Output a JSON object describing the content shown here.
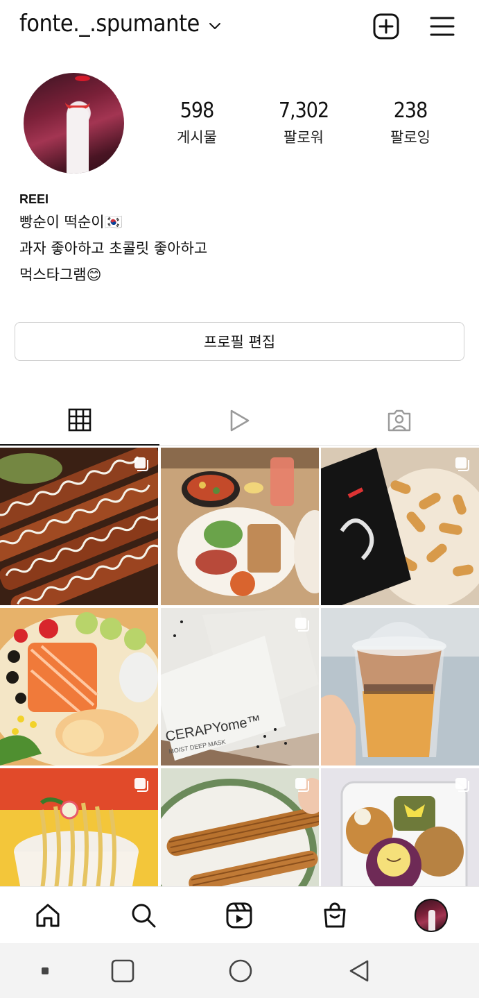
{
  "header": {
    "username": "fonte._.spumante",
    "icons": {
      "dropdown": "chevron-down-icon",
      "create": "plus-square-icon",
      "menu": "hamburger-menu-icon"
    }
  },
  "profile": {
    "stats": {
      "posts": {
        "value": "598",
        "label": "게시물"
      },
      "followers": {
        "value": "7,302",
        "label": "팔로워"
      },
      "following": {
        "value": "238",
        "label": "팔로잉"
      }
    },
    "bio": {
      "name": "REEI",
      "lines": [
        "빵순이 떡순이🇰🇷",
        "과자 좋아하고 초콜릿 좋아하고",
        "먹스타그램😊"
      ]
    },
    "edit_button_label": "프로필 편집"
  },
  "tabs": [
    {
      "icon": "grid-icon",
      "selected": true
    },
    {
      "icon": "reels-play-icon",
      "selected": false
    },
    {
      "icon": "tagged-person-icon",
      "selected": false
    }
  ],
  "grid": {
    "posts": [
      {
        "subject": "grilled skewers with mayo and sauce",
        "multi": true
      },
      {
        "subject": "brunch plate with pizza and juice",
        "multi": false
      },
      {
        "subject": "snack bag with crackers",
        "multi": true
      },
      {
        "subject": "salmon salad with eggs",
        "multi": false
      },
      {
        "subject": "CERAPYome moist deep mask packs",
        "multi": true,
        "text": [
          "CERAPYome™",
          "MOIST DEEP MASK"
        ]
      },
      {
        "subject": "iced milk tea in cup",
        "multi": false
      },
      {
        "subject": "instant noodles cup",
        "multi": true
      },
      {
        "subject": "churros on plate",
        "multi": true
      },
      {
        "subject": "muffins and cakes in box",
        "multi": true
      }
    ]
  },
  "bottom_nav": {
    "items": [
      "home-icon",
      "search-icon",
      "reels-icon",
      "shop-icon",
      "profile-avatar"
    ]
  },
  "system_nav": {
    "items": [
      "recent-apps-button",
      "home-button",
      "back-button"
    ]
  },
  "colors": {
    "text": "#111111",
    "border": "#cfcfcf",
    "nav_bg": "#f3f3f3"
  }
}
